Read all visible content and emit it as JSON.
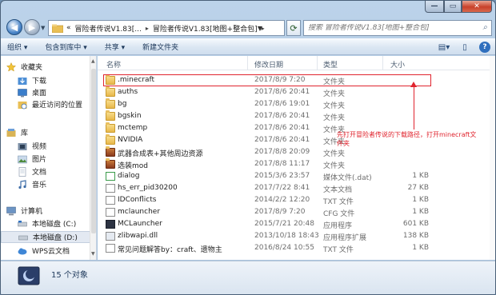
{
  "window": {
    "caption_min": "—",
    "caption_max": "▭",
    "caption_close": "✕"
  },
  "address_bar": {
    "overflow": "«",
    "crumbs": [
      "冒险者传说V1.83[...",
      "冒险者传说V1.83[地图+整合包]"
    ],
    "separator": "▸"
  },
  "search": {
    "placeholder": "搜索 冒险者传说V1.83[地图+整合包]"
  },
  "toolbar": {
    "organize": "组织 ▾",
    "include_in_library": "包含到库中 ▾",
    "share": "共享 ▾",
    "new_folder": "新建文件夹"
  },
  "nav": {
    "favorites": "收藏夹",
    "downloads": "下载",
    "desktop": "桌面",
    "recent": "最近访问的位置",
    "libraries": "库",
    "videos": "视频",
    "pictures": "图片",
    "documents": "文档",
    "music": "音乐",
    "computer": "计算机",
    "disk_c": "本地磁盘 (C:)",
    "disk_d": "本地磁盘 (D:)",
    "wps": "WPS云文档"
  },
  "columns": {
    "name": "名称",
    "date": "修改日期",
    "type": "类型",
    "size": "大小"
  },
  "files": [
    {
      "name": ".minecraft",
      "date": "2017/8/9 7:20",
      "type": "文件夹",
      "size": "",
      "icon": "folder"
    },
    {
      "name": "auths",
      "date": "2017/8/6 20:41",
      "type": "文件夹",
      "size": "",
      "icon": "folder"
    },
    {
      "name": "bg",
      "date": "2017/8/6 19:01",
      "type": "文件夹",
      "size": "",
      "icon": "folder"
    },
    {
      "name": "bgskin",
      "date": "2017/8/6 20:41",
      "type": "文件夹",
      "size": "",
      "icon": "folder"
    },
    {
      "name": "mctemp",
      "date": "2017/8/6 20:41",
      "type": "文件夹",
      "size": "",
      "icon": "folder"
    },
    {
      "name": "NVIDIA",
      "date": "2017/8/6 20:41",
      "type": "文件夹",
      "size": "",
      "icon": "folder"
    },
    {
      "name": "武器合成表+其他周边资源",
      "date": "2017/8/8 20:09",
      "type": "文件夹",
      "size": "",
      "icon": "folder-special"
    },
    {
      "name": "选装mod",
      "date": "2017/8/8 11:17",
      "type": "文件夹",
      "size": "",
      "icon": "folder-special"
    },
    {
      "name": "dialog",
      "date": "2015/3/6 23:57",
      "type": "媒体文件(.dat)",
      "size": "1 KB",
      "icon": "media"
    },
    {
      "name": "hs_err_pid30200",
      "date": "2017/7/22 8:41",
      "type": "文本文档",
      "size": "27 KB",
      "icon": "text"
    },
    {
      "name": "IDConflicts",
      "date": "2014/2/2 12:20",
      "type": "TXT 文件",
      "size": "1 KB",
      "icon": "text"
    },
    {
      "name": "mclauncher",
      "date": "2017/8/9 7:20",
      "type": "CFG 文件",
      "size": "1 KB",
      "icon": "text"
    },
    {
      "name": "MCLauncher",
      "date": "2015/7/21 20:48",
      "type": "应用程序",
      "size": "601 KB",
      "icon": "app"
    },
    {
      "name": "zlibwapi.dll",
      "date": "2013/10/18 18:43",
      "type": "应用程序扩展",
      "size": "138 KB",
      "icon": "dll"
    },
    {
      "name": "常见问题解答by：craft、遗物主",
      "date": "2016/8/24 10:55",
      "type": "TXT 文件",
      "size": "1 KB",
      "icon": "text"
    }
  ],
  "annotation": {
    "text": "先打开冒险者传说的下载路径，打开minecraft文件夹",
    "color": "#e0242e"
  },
  "details": {
    "count": "15 个对象"
  }
}
